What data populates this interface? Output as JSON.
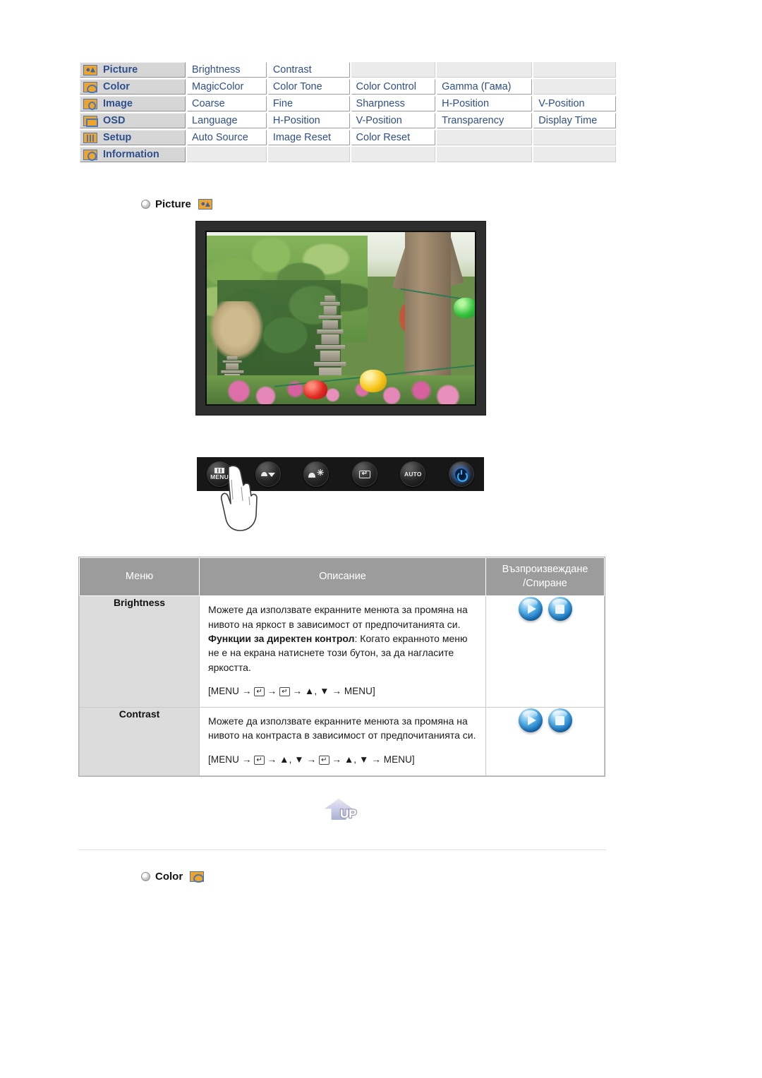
{
  "nav_table": {
    "rows": [
      {
        "icon": "picture-icon",
        "category": "Picture",
        "items": [
          "Brightness",
          "Contrast",
          "",
          "",
          ""
        ]
      },
      {
        "icon": "color-icon",
        "category": "Color",
        "items": [
          "MagicColor",
          "Color Tone",
          "Color Control",
          "Gamma (Гама)",
          ""
        ]
      },
      {
        "icon": "image-icon",
        "category": "Image",
        "items": [
          "Coarse",
          "Fine",
          "Sharpness",
          "H-Position",
          "V-Position"
        ]
      },
      {
        "icon": "osd-icon",
        "category": "OSD",
        "items": [
          "Language",
          "H-Position",
          "V-Position",
          "Transparency",
          "Display Time"
        ]
      },
      {
        "icon": "setup-icon",
        "category": "Setup",
        "items": [
          "Auto Source",
          "Image Reset",
          "Color Reset",
          "",
          ""
        ]
      },
      {
        "icon": "info-icon",
        "category": "Information",
        "items": [
          "",
          "",
          "",
          "",
          ""
        ]
      }
    ]
  },
  "section_picture": {
    "bullet": "bullet-icon",
    "title": "Picture",
    "icon": "picture-icon"
  },
  "section_color": {
    "bullet": "bullet-icon",
    "title": "Color",
    "icon": "color-icon"
  },
  "monitor": {
    "alt": "monitor-display-garden-photo"
  },
  "control_bar": {
    "buttons": [
      {
        "name": "menu-button",
        "label": "MENU",
        "icon": "osd-menu-icon"
      },
      {
        "name": "updown-button",
        "label": "",
        "icon": "up-down-arrow-icon"
      },
      {
        "name": "brightness-button",
        "label": "",
        "icon": "brightness-icon"
      },
      {
        "name": "enter-button",
        "label": "",
        "icon": "enter-icon"
      },
      {
        "name": "auto-button",
        "label": "AUTO",
        "icon": "auto-icon"
      },
      {
        "name": "power-button",
        "label": "",
        "icon": "power-icon"
      }
    ],
    "hand": "pointing-hand-icon"
  },
  "desc_table": {
    "headers": {
      "menu": "Меню",
      "description": "Описание",
      "playstop_line1": "Възпроизвеждане",
      "playstop_line2": "/Спиране"
    },
    "rows": [
      {
        "menu": "Brightness",
        "body_1": "Можете да използвате екранните менюта за промяна на нивото на яркост в зависимост от предпочитанията си.",
        "bold_lead": "Функции за директен контрол",
        "body_2": ": Когато екранното меню не е на екрана натиснете този бутон, за да нагласите яркостта.",
        "path_pre": "[MENU →",
        "path_mid_1": "→",
        "path_mid_2": "→ ▲, ▼ → MENU]",
        "path_keys": [
          "↵",
          "↵"
        ],
        "buttons": [
          "play-button",
          "stop-button"
        ]
      },
      {
        "menu": "Contrast",
        "body_1": "Можете да използвате екранните менюта за промяна на нивото на контраста в зависимост от предпочитанията си.",
        "bold_lead": "",
        "body_2": "",
        "path_pre": "[MENU →",
        "path_mid_1": "→ ▲, ▼ →",
        "path_mid_2": "→ ▲, ▼ → MENU]",
        "path_keys": [
          "↵",
          "↵"
        ],
        "buttons": [
          "play-button",
          "stop-button"
        ]
      }
    ]
  },
  "up_button": {
    "label": "UP",
    "icon": "up-arrow-icon"
  },
  "colors": {
    "nav_text": "#2d4f8e",
    "nav_category_bg": "#d6d6d6",
    "nav_empty_bg": "#ebebeb",
    "desc_header_bg": "#9c9c9c",
    "desc_menu_bg": "#dcdcdc",
    "icon_orange": "#f0a42a",
    "icon_border_blue": "#4a77b8",
    "button_blue": "#1b78c2",
    "power_glow": "#35b4ff"
  }
}
